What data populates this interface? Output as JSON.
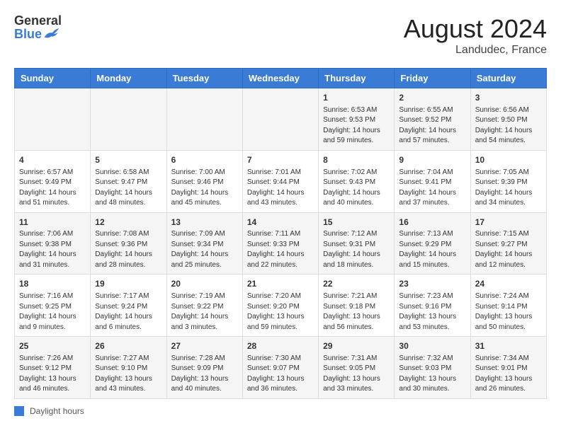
{
  "header": {
    "logo_general": "General",
    "logo_blue": "Blue",
    "month_year": "August 2024",
    "location": "Landudec, France"
  },
  "days_of_week": [
    "Sunday",
    "Monday",
    "Tuesday",
    "Wednesday",
    "Thursday",
    "Friday",
    "Saturday"
  ],
  "footer": {
    "label": "Daylight hours"
  },
  "weeks": [
    [
      {
        "day": "",
        "info": ""
      },
      {
        "day": "",
        "info": ""
      },
      {
        "day": "",
        "info": ""
      },
      {
        "day": "",
        "info": ""
      },
      {
        "day": "1",
        "info": "Sunrise: 6:53 AM\nSunset: 9:53 PM\nDaylight: 14 hours\nand 59 minutes."
      },
      {
        "day": "2",
        "info": "Sunrise: 6:55 AM\nSunset: 9:52 PM\nDaylight: 14 hours\nand 57 minutes."
      },
      {
        "day": "3",
        "info": "Sunrise: 6:56 AM\nSunset: 9:50 PM\nDaylight: 14 hours\nand 54 minutes."
      }
    ],
    [
      {
        "day": "4",
        "info": "Sunrise: 6:57 AM\nSunset: 9:49 PM\nDaylight: 14 hours\nand 51 minutes."
      },
      {
        "day": "5",
        "info": "Sunrise: 6:58 AM\nSunset: 9:47 PM\nDaylight: 14 hours\nand 48 minutes."
      },
      {
        "day": "6",
        "info": "Sunrise: 7:00 AM\nSunset: 9:46 PM\nDaylight: 14 hours\nand 45 minutes."
      },
      {
        "day": "7",
        "info": "Sunrise: 7:01 AM\nSunset: 9:44 PM\nDaylight: 14 hours\nand 43 minutes."
      },
      {
        "day": "8",
        "info": "Sunrise: 7:02 AM\nSunset: 9:43 PM\nDaylight: 14 hours\nand 40 minutes."
      },
      {
        "day": "9",
        "info": "Sunrise: 7:04 AM\nSunset: 9:41 PM\nDaylight: 14 hours\nand 37 minutes."
      },
      {
        "day": "10",
        "info": "Sunrise: 7:05 AM\nSunset: 9:39 PM\nDaylight: 14 hours\nand 34 minutes."
      }
    ],
    [
      {
        "day": "11",
        "info": "Sunrise: 7:06 AM\nSunset: 9:38 PM\nDaylight: 14 hours\nand 31 minutes."
      },
      {
        "day": "12",
        "info": "Sunrise: 7:08 AM\nSunset: 9:36 PM\nDaylight: 14 hours\nand 28 minutes."
      },
      {
        "day": "13",
        "info": "Sunrise: 7:09 AM\nSunset: 9:34 PM\nDaylight: 14 hours\nand 25 minutes."
      },
      {
        "day": "14",
        "info": "Sunrise: 7:11 AM\nSunset: 9:33 PM\nDaylight: 14 hours\nand 22 minutes."
      },
      {
        "day": "15",
        "info": "Sunrise: 7:12 AM\nSunset: 9:31 PM\nDaylight: 14 hours\nand 18 minutes."
      },
      {
        "day": "16",
        "info": "Sunrise: 7:13 AM\nSunset: 9:29 PM\nDaylight: 14 hours\nand 15 minutes."
      },
      {
        "day": "17",
        "info": "Sunrise: 7:15 AM\nSunset: 9:27 PM\nDaylight: 14 hours\nand 12 minutes."
      }
    ],
    [
      {
        "day": "18",
        "info": "Sunrise: 7:16 AM\nSunset: 9:25 PM\nDaylight: 14 hours\nand 9 minutes."
      },
      {
        "day": "19",
        "info": "Sunrise: 7:17 AM\nSunset: 9:24 PM\nDaylight: 14 hours\nand 6 minutes."
      },
      {
        "day": "20",
        "info": "Sunrise: 7:19 AM\nSunset: 9:22 PM\nDaylight: 14 hours\nand 3 minutes."
      },
      {
        "day": "21",
        "info": "Sunrise: 7:20 AM\nSunset: 9:20 PM\nDaylight: 13 hours\nand 59 minutes."
      },
      {
        "day": "22",
        "info": "Sunrise: 7:21 AM\nSunset: 9:18 PM\nDaylight: 13 hours\nand 56 minutes."
      },
      {
        "day": "23",
        "info": "Sunrise: 7:23 AM\nSunset: 9:16 PM\nDaylight: 13 hours\nand 53 minutes."
      },
      {
        "day": "24",
        "info": "Sunrise: 7:24 AM\nSunset: 9:14 PM\nDaylight: 13 hours\nand 50 minutes."
      }
    ],
    [
      {
        "day": "25",
        "info": "Sunrise: 7:26 AM\nSunset: 9:12 PM\nDaylight: 13 hours\nand 46 minutes."
      },
      {
        "day": "26",
        "info": "Sunrise: 7:27 AM\nSunset: 9:10 PM\nDaylight: 13 hours\nand 43 minutes."
      },
      {
        "day": "27",
        "info": "Sunrise: 7:28 AM\nSunset: 9:09 PM\nDaylight: 13 hours\nand 40 minutes."
      },
      {
        "day": "28",
        "info": "Sunrise: 7:30 AM\nSunset: 9:07 PM\nDaylight: 13 hours\nand 36 minutes."
      },
      {
        "day": "29",
        "info": "Sunrise: 7:31 AM\nSunset: 9:05 PM\nDaylight: 13 hours\nand 33 minutes."
      },
      {
        "day": "30",
        "info": "Sunrise: 7:32 AM\nSunset: 9:03 PM\nDaylight: 13 hours\nand 30 minutes."
      },
      {
        "day": "31",
        "info": "Sunrise: 7:34 AM\nSunset: 9:01 PM\nDaylight: 13 hours\nand 26 minutes."
      }
    ]
  ]
}
